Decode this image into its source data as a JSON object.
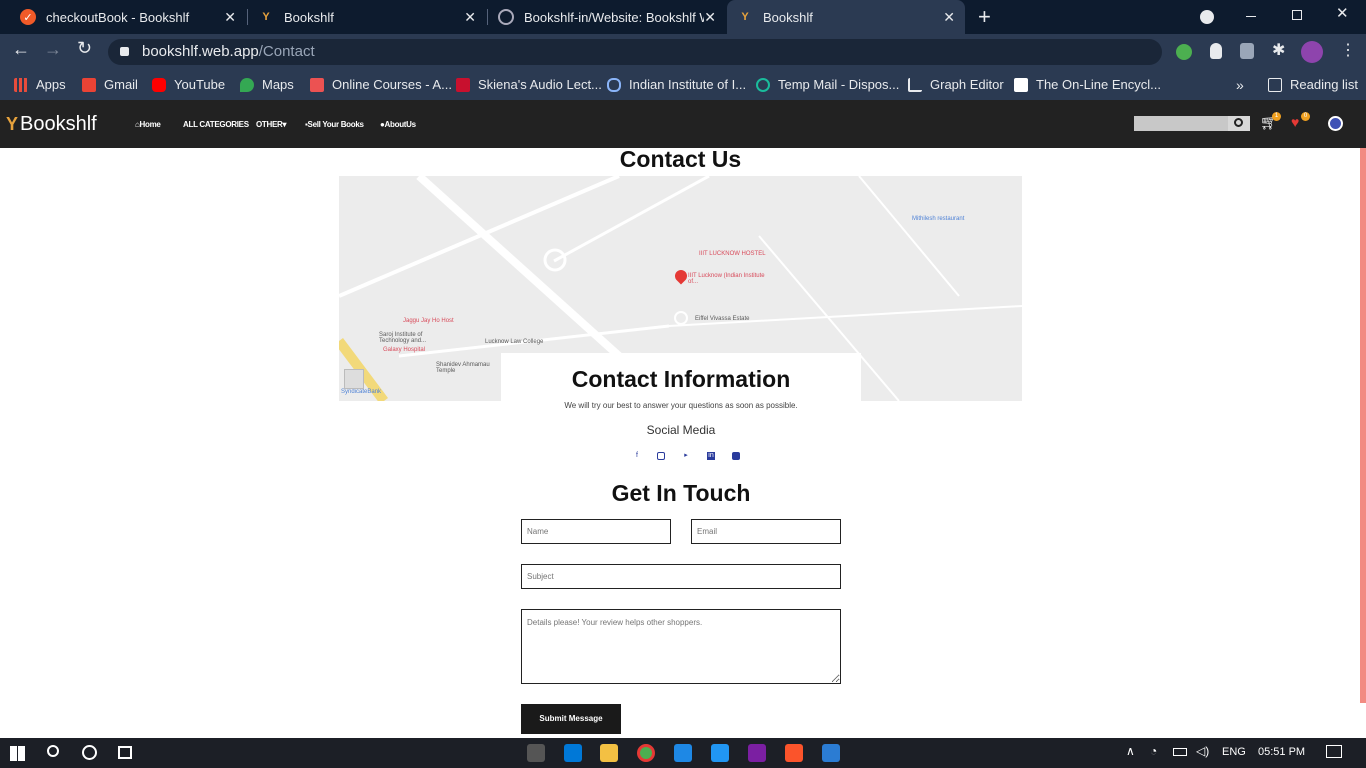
{
  "browser": {
    "tabs": [
      {
        "title": "checkoutBook - Bookshlf"
      },
      {
        "title": "Bookshlf"
      },
      {
        "title": "Bookshlf-in/Website: Bookshlf W"
      },
      {
        "title": "Bookshlf"
      }
    ],
    "new_tab_label": "+",
    "url_host": "bookshlf.web.app",
    "url_path": "/Contact",
    "bookmarks": [
      {
        "label": "Apps"
      },
      {
        "label": "Gmail"
      },
      {
        "label": "YouTube"
      },
      {
        "label": "Maps"
      },
      {
        "label": "Online Courses - A..."
      },
      {
        "label": "Skiena's Audio Lect..."
      },
      {
        "label": "Indian Institute of I..."
      },
      {
        "label": "Temp Mail - Dispos..."
      },
      {
        "label": "Graph Editor"
      },
      {
        "label": "The On-Line Encycl..."
      }
    ],
    "more_bookmarks": "»",
    "reading_list": "Reading list"
  },
  "site": {
    "logo": "Bookshlf",
    "nav": [
      {
        "label": "Home"
      },
      {
        "label": "ALL CATEGORIES"
      },
      {
        "label": "OTHER"
      },
      {
        "label": "Sell Your Books"
      },
      {
        "label": "AboutUs"
      }
    ],
    "cart_count": "1",
    "wishlist_count": "0"
  },
  "page": {
    "title": "Contact Us",
    "map_labels": [
      {
        "text": "IIIT LUCKNOW HOSTEL",
        "kind": "red"
      },
      {
        "text": "IIIT Lucknow (Indian Institute of...",
        "kind": "red"
      },
      {
        "text": "Mithilesh restaurant",
        "kind": "blue"
      },
      {
        "text": "Eiffel Vivassa Estate",
        "kind": "gray"
      },
      {
        "text": "Jaggu Jay Ho Host",
        "kind": "red"
      },
      {
        "text": "Saroj Institute of Technology and...",
        "kind": "gray"
      },
      {
        "text": "Galaxy Hospital",
        "kind": "red"
      },
      {
        "text": "Lucknow Law College",
        "kind": "gray"
      },
      {
        "text": "Shanidev Ahmamau Temple",
        "kind": "gray"
      },
      {
        "text": "SyndicateBank",
        "kind": "blue"
      }
    ],
    "info_title": "Contact Information",
    "info_subtitle": "We will try our best to answer your questions as soon as possible.",
    "social_title": "Social Media",
    "social_icons": [
      "facebook-icon",
      "instagram-icon",
      "twitter-icon",
      "linkedin-icon",
      "youtube-icon"
    ],
    "form_title": "Get In Touch",
    "form": {
      "name_placeholder": "Name",
      "email_placeholder": "Email",
      "subject_placeholder": "Subject",
      "details_placeholder": "Details please! Your review helps other shoppers.",
      "submit_label": "Submit Message"
    }
  },
  "taskbar": {
    "language": "ENG",
    "time": "05:51 PM"
  },
  "colors": {
    "site_nav_bg": "#222222",
    "accent_red": "#e05a5a",
    "chrome_bg": "#2b3a52"
  }
}
